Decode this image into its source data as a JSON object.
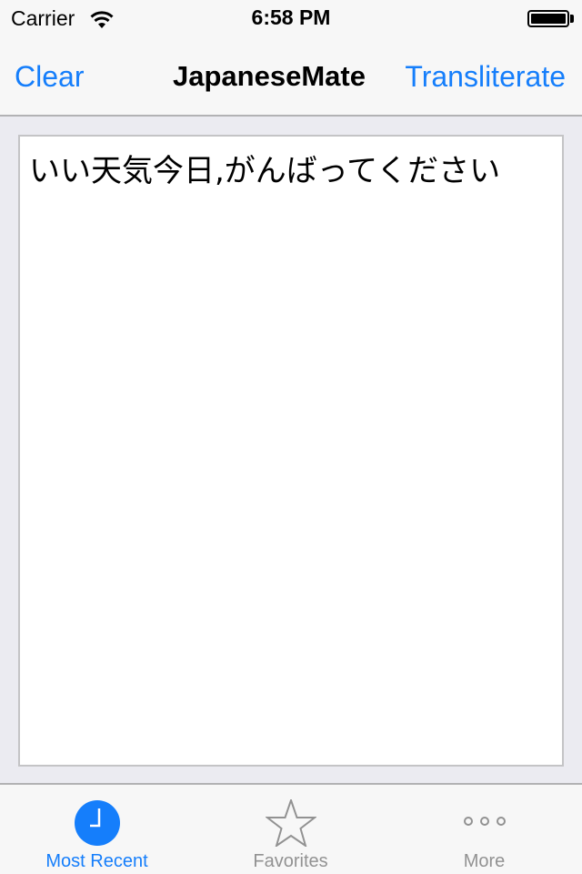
{
  "status_bar": {
    "carrier": "Carrier",
    "time": "6:58 PM",
    "battery_level": 1.0,
    "icons": [
      "wifi-icon",
      "battery-icon"
    ]
  },
  "nav_bar": {
    "left_button": "Clear",
    "title": "JapaneseMate",
    "right_button": "Transliterate"
  },
  "editor": {
    "text": "いい天気今日,がんばってください"
  },
  "tab_bar": {
    "tabs": [
      {
        "label": "Most Recent",
        "icon": "clock-icon",
        "active": true
      },
      {
        "label": "Favorites",
        "icon": "star-icon",
        "active": false
      },
      {
        "label": "More",
        "icon": "more-icon",
        "active": false
      }
    ]
  },
  "colors": {
    "accent": "#157efb",
    "inactive": "#929292",
    "background": "#ebebf1"
  }
}
